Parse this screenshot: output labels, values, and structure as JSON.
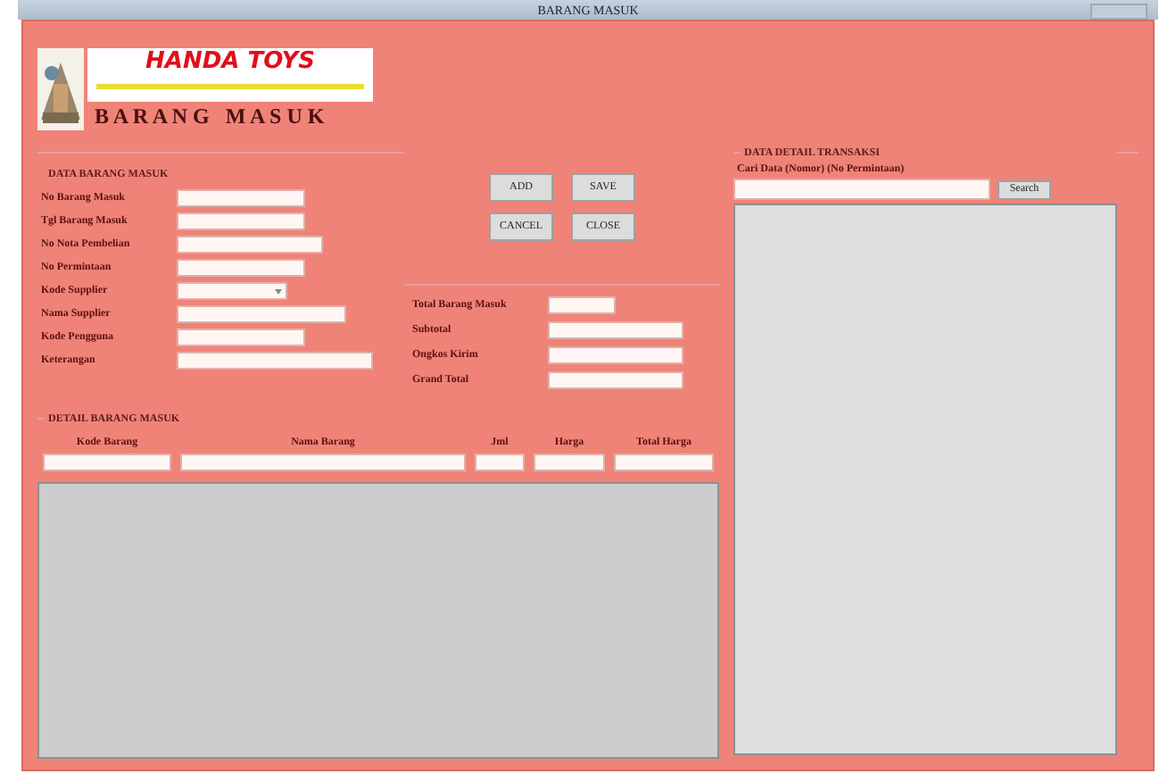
{
  "window": {
    "title": "BARANG MASUK"
  },
  "header": {
    "brand": "HANDA TOYS",
    "title": "B A R A N G   M A S U K"
  },
  "form": {
    "title": "DATA BARANG MASUK",
    "fields": [
      {
        "label": "No Barang Masuk",
        "kind": "text"
      },
      {
        "label": "Tgl Barang Masuk",
        "kind": "text"
      },
      {
        "label": "No Nota Pembelian",
        "kind": "text"
      },
      {
        "label": "No Permintaan",
        "kind": "text"
      },
      {
        "label": "Kode Supplier",
        "kind": "combo"
      },
      {
        "label": "Nama Supplier",
        "kind": "text"
      },
      {
        "label": "Kode Pengguna",
        "kind": "text"
      },
      {
        "label": "Keterangan",
        "kind": "text"
      }
    ]
  },
  "buttons": [
    "ADD",
    "SAVE",
    "CANCEL",
    "CLOSE"
  ],
  "totals": [
    {
      "label": "Total Barang Masuk"
    },
    {
      "label": "Subtotal"
    },
    {
      "label": "Ongkos Kirim"
    },
    {
      "label": "Grand Total"
    }
  ],
  "detail": {
    "title": "DETAIL BARANG MASUK",
    "columns": [
      "Kode Barang",
      "Nama Barang",
      "Jml",
      "Harga",
      "Total Harga"
    ]
  },
  "search": {
    "title": "DATA DETAIL TRANSAKSI",
    "hint": "Cari Data (Nomor) (No Permintaan)",
    "button": "Search"
  }
}
